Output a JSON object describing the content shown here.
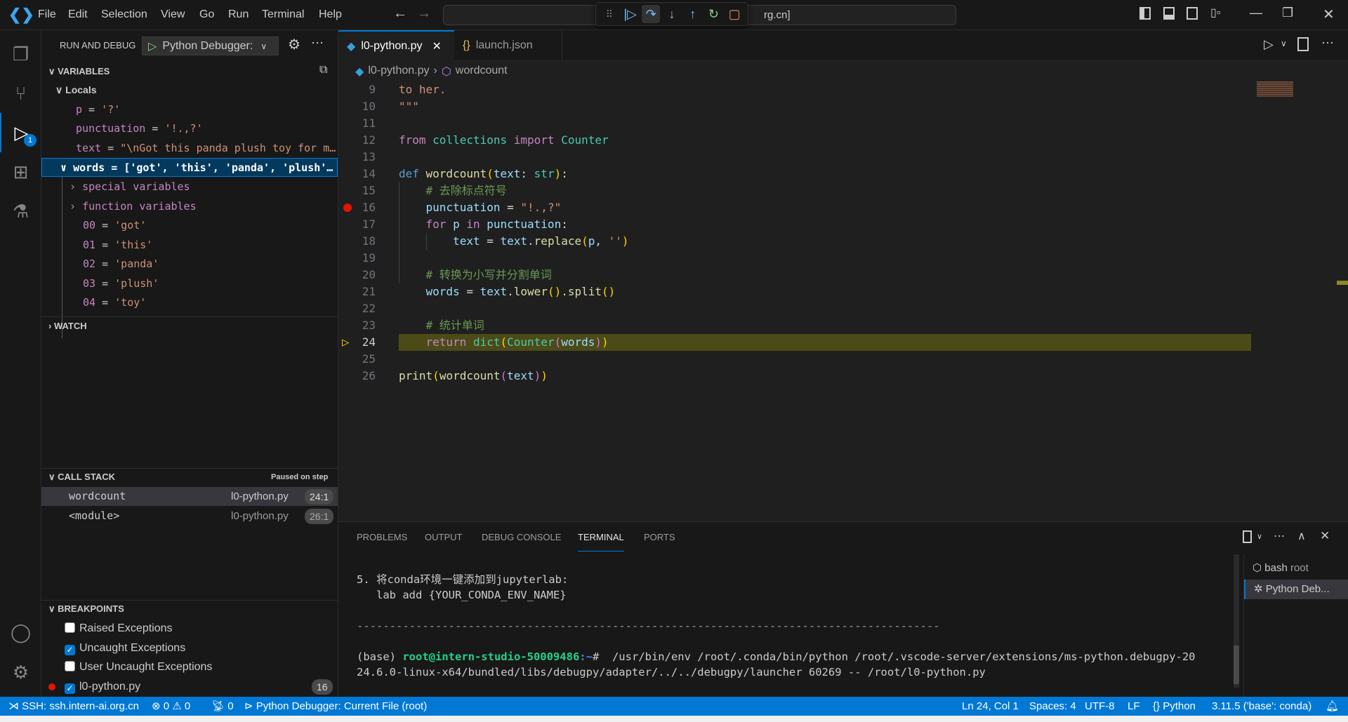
{
  "menu": [
    "File",
    "Edit",
    "Selection",
    "View",
    "Go",
    "Run",
    "Terminal",
    "Help"
  ],
  "command_center": {
    "text": "rg.cn]"
  },
  "debug_toolbar": {
    "icons": [
      "grip-icon",
      "continue-icon",
      "step-over-icon",
      "step-into-icon",
      "step-out-icon",
      "restart-icon",
      "stop-icon"
    ]
  },
  "sidebar": {
    "title": "RUN AND DEBUG",
    "config": "Python Debugger: ",
    "variables_header": "VARIABLES",
    "locals_label": "Locals",
    "locals": [
      {
        "name": "p",
        "value": "'?'"
      },
      {
        "name": "punctuation",
        "value": "'!.,?'"
      },
      {
        "name": "text",
        "value": "\"\\nGot this panda plush toy for m…"
      }
    ],
    "words": {
      "name": "words",
      "value": "['got', 'this', 'panda', 'plush'…"
    },
    "words_children": [
      "special variables",
      "function variables"
    ],
    "words_items": [
      {
        "name": "00",
        "value": "'got'"
      },
      {
        "name": "01",
        "value": "'this'"
      },
      {
        "name": "02",
        "value": "'panda'"
      },
      {
        "name": "03",
        "value": "'plush'"
      },
      {
        "name": "04",
        "value": "'toy'"
      }
    ],
    "watch_header": "WATCH",
    "callstack_header": "CALL STACK",
    "callstack_status": "Paused on step",
    "callstack": [
      {
        "name": "wordcount",
        "file": "l0-python.py",
        "pos": "24:1"
      },
      {
        "name": "<module>",
        "file": "l0-python.py",
        "pos": "26:1"
      }
    ],
    "breakpoints_header": "BREAKPOINTS",
    "breakpoints": [
      {
        "label": "Raised Exceptions",
        "checked": false
      },
      {
        "label": "Uncaught Exceptions",
        "checked": true
      },
      {
        "label": "User Uncaught Exceptions",
        "checked": false
      },
      {
        "label": "l0-python.py",
        "checked": true,
        "line": "16"
      }
    ],
    "debug_badge": "1"
  },
  "editor": {
    "tabs": [
      {
        "label": "l0-python.py",
        "active": true
      },
      {
        "label": "launch.json",
        "active": false
      }
    ],
    "breadcrumb": {
      "file": "l0-python.py",
      "symbol": "wordcount"
    },
    "breakpoint_line": 16,
    "current_line": 24,
    "lines": [
      {
        "n": "9",
        "t": [
          [
            "to her.",
            "str"
          ]
        ]
      },
      {
        "n": "10",
        "t": [
          [
            "\"\"\"",
            "str"
          ]
        ]
      },
      {
        "n": "11",
        "t": []
      },
      {
        "n": "12",
        "t": [
          [
            "from ",
            "kw"
          ],
          [
            "collections ",
            "cls"
          ],
          [
            "import ",
            "kw"
          ],
          [
            "Counter",
            "cls"
          ]
        ]
      },
      {
        "n": "13",
        "t": []
      },
      {
        "n": "14",
        "t": [
          [
            "def ",
            "def"
          ],
          [
            "wordcount",
            "fn"
          ],
          [
            "(",
            "b1"
          ],
          [
            "text",
            "var"
          ],
          [
            ": ",
            "p"
          ],
          [
            "str",
            "cls"
          ],
          [
            ")",
            "b1"
          ],
          [
            ":",
            "p"
          ]
        ]
      },
      {
        "n": "15",
        "t": [
          [
            "    ",
            "p"
          ],
          [
            "# 去除标点符号",
            "cm"
          ]
        ]
      },
      {
        "n": "16",
        "t": [
          [
            "    ",
            "p"
          ],
          [
            "punctuation",
            "var"
          ],
          [
            " = ",
            "p"
          ],
          [
            "\"!.,?\"",
            "str"
          ]
        ]
      },
      {
        "n": "17",
        "t": [
          [
            "    ",
            "p"
          ],
          [
            "for ",
            "kw"
          ],
          [
            "p ",
            "var"
          ],
          [
            "in ",
            "kw"
          ],
          [
            "punctuation",
            "var"
          ],
          [
            ":",
            "p"
          ]
        ]
      },
      {
        "n": "18",
        "t": [
          [
            "        ",
            "p"
          ],
          [
            "text",
            "var"
          ],
          [
            " = ",
            "p"
          ],
          [
            "text",
            "var"
          ],
          [
            ".",
            "p"
          ],
          [
            "replace",
            "fn"
          ],
          [
            "(",
            "b1"
          ],
          [
            "p",
            "var"
          ],
          [
            ", ",
            "p"
          ],
          [
            "''",
            "str"
          ],
          [
            ")",
            "b1"
          ]
        ]
      },
      {
        "n": "19",
        "t": []
      },
      {
        "n": "20",
        "t": [
          [
            "    ",
            "p"
          ],
          [
            "# 转换为小写并分割单词",
            "cm"
          ]
        ]
      },
      {
        "n": "21",
        "t": [
          [
            "    ",
            "p"
          ],
          [
            "words",
            "var"
          ],
          [
            " = ",
            "p"
          ],
          [
            "text",
            "var"
          ],
          [
            ".",
            "p"
          ],
          [
            "lower",
            "fn"
          ],
          [
            "()",
            "b1"
          ],
          [
            ".",
            "p"
          ],
          [
            "split",
            "fn"
          ],
          [
            "()",
            "b1"
          ]
        ]
      },
      {
        "n": "22",
        "t": []
      },
      {
        "n": "23",
        "t": [
          [
            "    ",
            "p"
          ],
          [
            "# 统计单词",
            "cm"
          ]
        ]
      },
      {
        "n": "24",
        "t": [
          [
            "    ",
            "p"
          ],
          [
            "return ",
            "kw"
          ],
          [
            "dict",
            "cls"
          ],
          [
            "(",
            "b1"
          ],
          [
            "Counter",
            "cls"
          ],
          [
            "(",
            "b2"
          ],
          [
            "words",
            "var"
          ],
          [
            ")",
            "b2"
          ],
          [
            ")",
            "b1"
          ]
        ]
      },
      {
        "n": "25",
        "t": []
      },
      {
        "n": "26",
        "t": [
          [
            "print",
            "fn"
          ],
          [
            "(",
            "b1"
          ],
          [
            "wordcount",
            "fn"
          ],
          [
            "(",
            "b2"
          ],
          [
            "text",
            "var"
          ],
          [
            ")",
            "b2"
          ],
          [
            ")",
            "b1"
          ]
        ]
      }
    ]
  },
  "panel": {
    "tabs": [
      "PROBLEMS",
      "OUTPUT",
      "DEBUG CONSOLE",
      "TERMINAL",
      "PORTS"
    ],
    "active_tab": "TERMINAL",
    "terminal": {
      "line1": "5. 将conda环境一键添加到jupyterlab:",
      "line2": "   lab add {YOUR_CONDA_ENV_NAME}",
      "separator": "-----------------------------------------------------------------------------------------",
      "prompt_base": "(base) ",
      "prompt_user": "root@intern-studio-50009486",
      "prompt_path": ":~",
      "prompt_hash": "# ",
      "command1": " /usr/bin/env /root/.conda/bin/python /root/.vscode-server/extensions/ms-python.debugpy-20",
      "command2": "24.6.0-linux-x64/bundled/libs/debugpy/adapter/../../debugpy/launcher 60269 -- /root/l0-python.py"
    },
    "terminals": [
      {
        "name": "bash",
        "detail": "root"
      },
      {
        "name": "Python Deb..."
      }
    ]
  },
  "status": {
    "remote": "SSH: ssh.intern-ai.org.cn",
    "errors": "0",
    "warnings": "0",
    "ports": "0",
    "debug": "Python Debugger: Current File (root)",
    "position": "Ln 24, Col 1",
    "spaces": "Spaces: 4",
    "encoding": "UTF-8",
    "eol": "LF",
    "language": "Python",
    "interpreter": "3.11.5 ('base': conda)"
  },
  "colors": {
    "accent": "#0078d4",
    "status_bar": "#0078d4",
    "current_line": "#4b4b18",
    "breakpoint": "#e51400"
  }
}
